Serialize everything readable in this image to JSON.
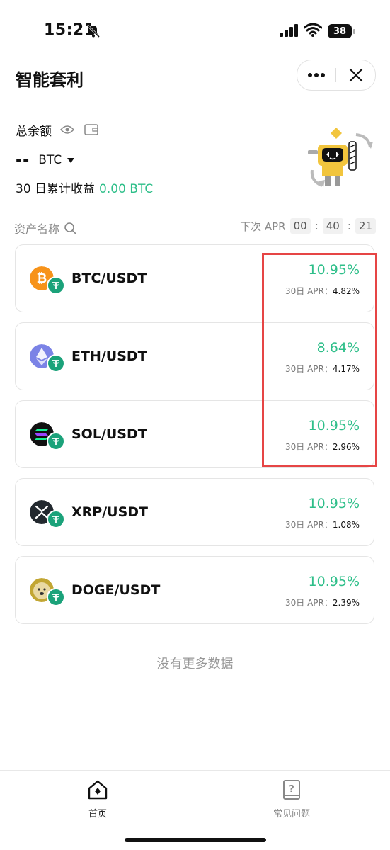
{
  "status_bar": {
    "time": "15:21",
    "battery": "38"
  },
  "header": {
    "title": "智能套利"
  },
  "balance": {
    "label": "总余额",
    "value": "--",
    "currency": "BTC",
    "profit_label": "30 日累计收益",
    "profit_value": "0.00 BTC"
  },
  "list_header": {
    "asset_col": "资产名称",
    "next_apr_label": "下次 APR",
    "timer": [
      "00",
      "40",
      "21"
    ]
  },
  "pairs": [
    {
      "name": "BTC/USDT",
      "apr": "10.95%",
      "apr30_label": "30日 APR：",
      "apr30": "4.82%",
      "icon": "bitcoin-icon"
    },
    {
      "name": "ETH/USDT",
      "apr": "8.64%",
      "apr30_label": "30日 APR：",
      "apr30": "4.17%",
      "icon": "ethereum-icon"
    },
    {
      "name": "SOL/USDT",
      "apr": "10.95%",
      "apr30_label": "30日 APR：",
      "apr30": "2.96%",
      "icon": "solana-icon"
    },
    {
      "name": "XRP/USDT",
      "apr": "10.95%",
      "apr30_label": "30日 APR：",
      "apr30": "1.08%",
      "icon": "xrp-icon"
    },
    {
      "name": "DOGE/USDT",
      "apr": "10.95%",
      "apr30_label": "30日 APR：",
      "apr30": "2.39%",
      "icon": "dogecoin-icon"
    }
  ],
  "no_more_text": "没有更多数据",
  "bottom_nav": {
    "home": "首页",
    "faq": "常见问题"
  },
  "colors": {
    "accent_green": "#2fbf8a",
    "highlight_red": "#e64545",
    "usdt_teal": "#1ba27a"
  }
}
